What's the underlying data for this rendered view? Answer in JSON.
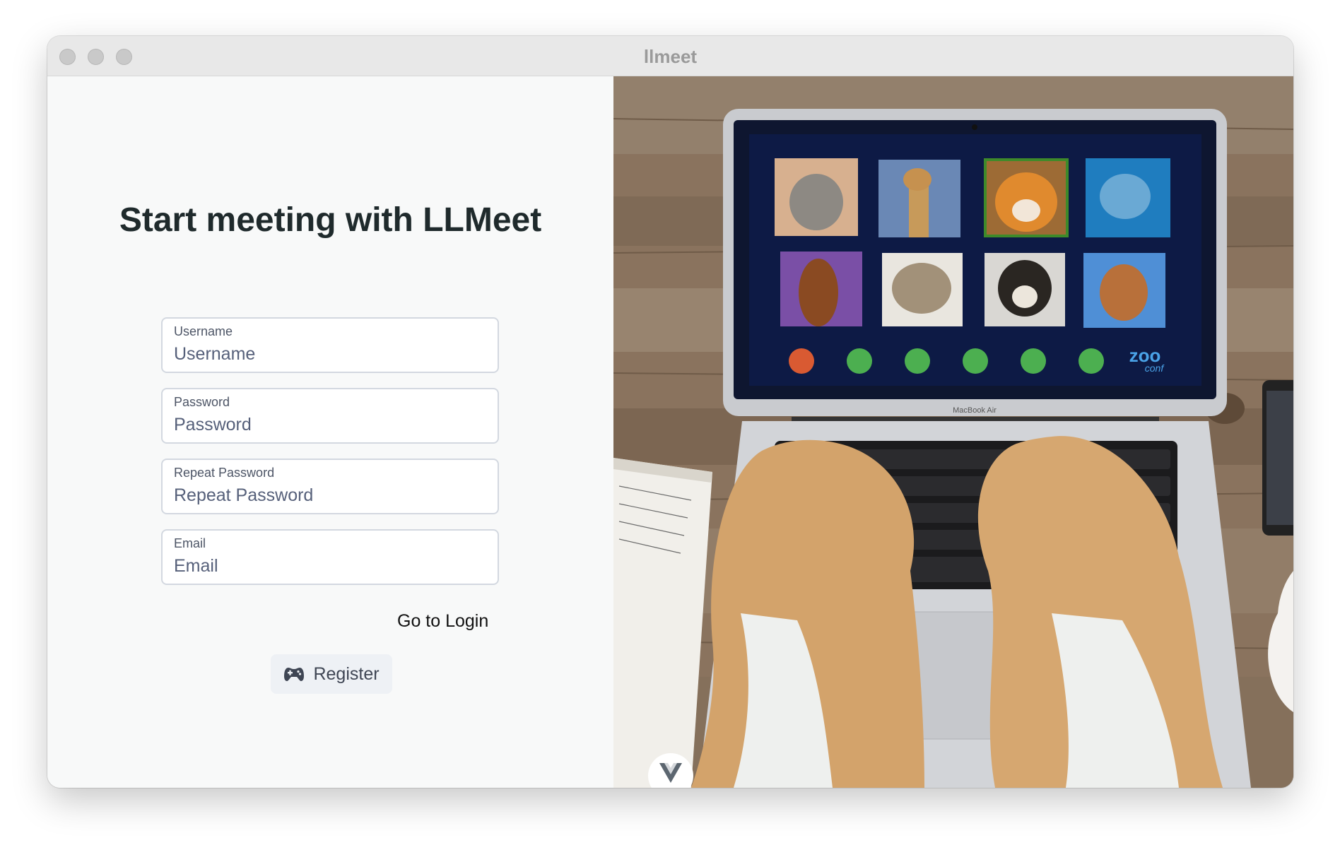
{
  "window": {
    "title": "llmeet"
  },
  "form": {
    "heading": "Start meeting with LLMeet",
    "fields": [
      {
        "label": "Username",
        "placeholder": "Username"
      },
      {
        "label": "Password",
        "placeholder": "Password"
      },
      {
        "label": "Repeat Password",
        "placeholder": "Repeat Password"
      },
      {
        "label": "Email",
        "placeholder": "Email"
      }
    ],
    "go_to_login": "Go to Login",
    "register_label": "Register",
    "register_icon": "gamepad-icon"
  },
  "hero": {
    "description_icon": "conference-laptop-photo",
    "zoo_logo_text": "zoo",
    "zoo_logo_sub": "conf",
    "laptop_brand": "MacBook Air",
    "badge_icon": "vue-logo-icon"
  }
}
